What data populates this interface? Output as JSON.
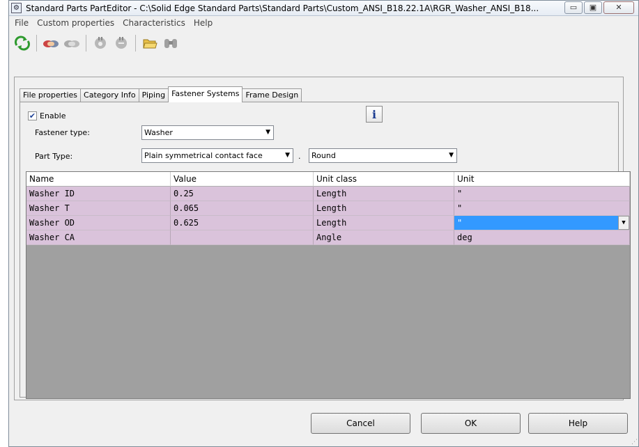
{
  "window": {
    "title": "Standard Parts PartEditor - C:\\Solid Edge Standard Parts\\Standard Parts\\Custom_ANSI_B18.22.1A\\RGR_Washer_ANSI_B18...",
    "minimize_glyph": "▭",
    "maximize_glyph": "▣",
    "close_glyph": "✕"
  },
  "menu": [
    "File",
    "Custom properties",
    "Characteristics",
    "Help"
  ],
  "toolbar": {
    "icons": [
      "refresh-icon",
      "handshake-icon",
      "handshake-disabled-icon",
      "plugin-icon",
      "plugin-remove-icon",
      "open-folder-icon",
      "binoculars-icon"
    ]
  },
  "tabs": [
    "File properties",
    "Category Info",
    "Piping",
    "Fastener Systems",
    "Frame Design"
  ],
  "active_tab": "Fastener Systems",
  "fastener": {
    "enable_label": "Enable",
    "enable_checked": true,
    "fastener_type_label": "Fastener type:",
    "fastener_type_value": "Washer",
    "part_type_label": "Part Type:",
    "part_type_value": "Plain symmetrical contact face",
    "part_type_separator": ".",
    "part_subtype_value": "Round"
  },
  "grid": {
    "columns": [
      "Name",
      "Value",
      "Unit class",
      "Unit"
    ],
    "rows": [
      {
        "name": "Washer ID",
        "value": "0.25",
        "unit_class": "Length",
        "unit": "\""
      },
      {
        "name": "Washer T",
        "value": "0.065",
        "unit_class": "Length",
        "unit": "\""
      },
      {
        "name": "Washer OD",
        "value": "0.625",
        "unit_class": "Length",
        "unit": "\""
      },
      {
        "name": "Washer CA",
        "value": "",
        "unit_class": "Angle",
        "unit": "deg"
      }
    ],
    "row_color": "#dac3db",
    "selection_color": "#3399ff",
    "empty_area_color": "#a0a0a0"
  },
  "buttons": {
    "cancel": "Cancel",
    "ok": "OK",
    "help": "Help"
  }
}
